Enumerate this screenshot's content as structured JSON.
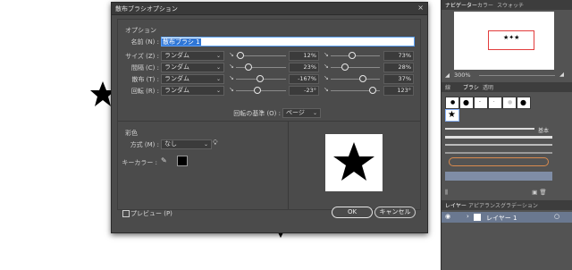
{
  "dialog": {
    "title": "散布ブラシオプション",
    "close_glyph": "×",
    "options_header": "オプション",
    "name_label": "名前 (N) :",
    "name_value": "散布ブラシ 1",
    "rows": [
      {
        "label": "サイズ (Z) :",
        "mode": "ランダム",
        "value1": "12%",
        "value2": "73%"
      },
      {
        "label": "間隔 (C) :",
        "mode": "ランダム",
        "value1": "23%",
        "value2": "28%"
      },
      {
        "label": "散布 (T) :",
        "mode": "ランダム",
        "value1": "-167%",
        "value2": "37%"
      },
      {
        "label": "回転 (R) :",
        "mode": "ランダム",
        "value1": "-23°",
        "value2": "123°"
      }
    ],
    "rotation_ref_label": "回転の基準 (O) :",
    "rotation_ref_value": "ページ",
    "color_header": "彩色",
    "method_label": "方式 (M) :",
    "method_value": "なし",
    "key_color_label": "キーカラー :",
    "preview_label": "プレビュー (P)",
    "ok_label": "OK",
    "cancel_label": "キャンセル"
  },
  "panels": {
    "top_tabs": [
      "ナビゲーター",
      "カラー",
      "スウォッチ"
    ],
    "zoom": "300%",
    "mid_tabs": [
      "線",
      "ブラシ",
      "透明"
    ],
    "basic_label": "基本",
    "bottom_tabs": [
      "レイヤー",
      "アピアランス",
      "グラデーション"
    ],
    "layer_name": "レイヤー 1"
  },
  "colors": {
    "dialog_bg": "#4b4b4b",
    "panel_bg": "#535353",
    "accent": "#2f76d6",
    "nav_rect": "#e23c3c"
  }
}
